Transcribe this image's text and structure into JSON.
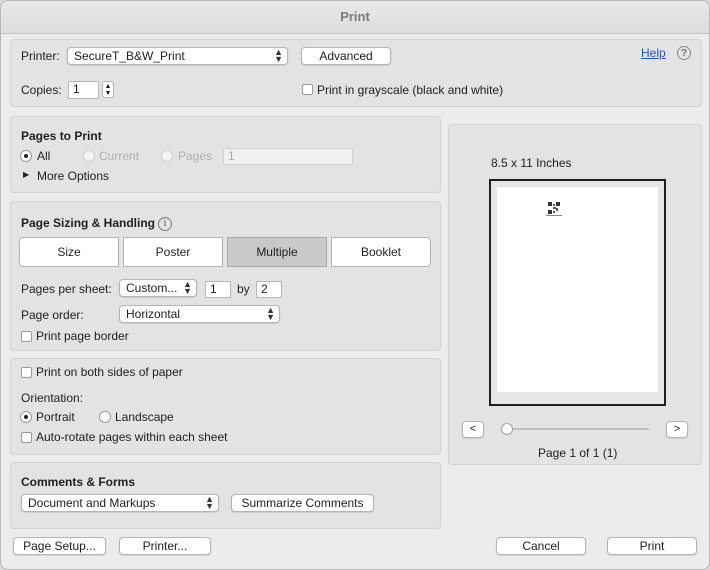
{
  "window": {
    "title": "Print"
  },
  "printer": {
    "label": "Printer:",
    "value": "SecureT_B&W_Print",
    "advanced_label": "Advanced",
    "help_label": "Help",
    "help_icon": "question-circle-icon"
  },
  "copies": {
    "label": "Copies:",
    "value": "1"
  },
  "grayscale": {
    "label": "Print in grayscale (black and white)",
    "checked": false
  },
  "pages_to_print": {
    "heading": "Pages to Print",
    "all_label": "All",
    "current_label": "Current",
    "pages_label": "Pages",
    "pages_value": "1",
    "selected": "All",
    "more_options_label": "More Options"
  },
  "sizing": {
    "heading": "Page Sizing & Handling",
    "info_icon": "info-icon",
    "modes": [
      "Size",
      "Poster",
      "Multiple",
      "Booklet"
    ],
    "selected_mode": "Multiple",
    "pages_per_sheet_label": "Pages per sheet:",
    "pages_per_sheet_value": "Custom...",
    "cols": "1",
    "by_label": "by",
    "rows": "2",
    "page_order_label": "Page order:",
    "page_order_value": "Horizontal",
    "page_border_label": "Print page border",
    "page_border_checked": false
  },
  "duplex": {
    "both_sides_label": "Print on both sides of paper",
    "both_sides_checked": false,
    "orientation_label": "Orientation:",
    "portrait_label": "Portrait",
    "landscape_label": "Landscape",
    "selected": "Portrait",
    "autorotate_label": "Auto-rotate pages within each sheet",
    "autorotate_checked": false
  },
  "comments": {
    "heading": "Comments & Forms",
    "value": "Document and Markups",
    "summarize_label": "Summarize Comments"
  },
  "preview": {
    "paper_size": "8.5 x 11 Inches",
    "prev_label": "<",
    "next_label": ">",
    "page_status": "Page 1 of 1 (1)",
    "slider_position": 0
  },
  "footer": {
    "page_setup_label": "Page Setup...",
    "printer_label": "Printer...",
    "cancel_label": "Cancel",
    "print_label": "Print"
  },
  "colors": {
    "accent": "#1a56c8",
    "window_bg": "#ececec",
    "panel_bg": "#e3e3e3"
  }
}
